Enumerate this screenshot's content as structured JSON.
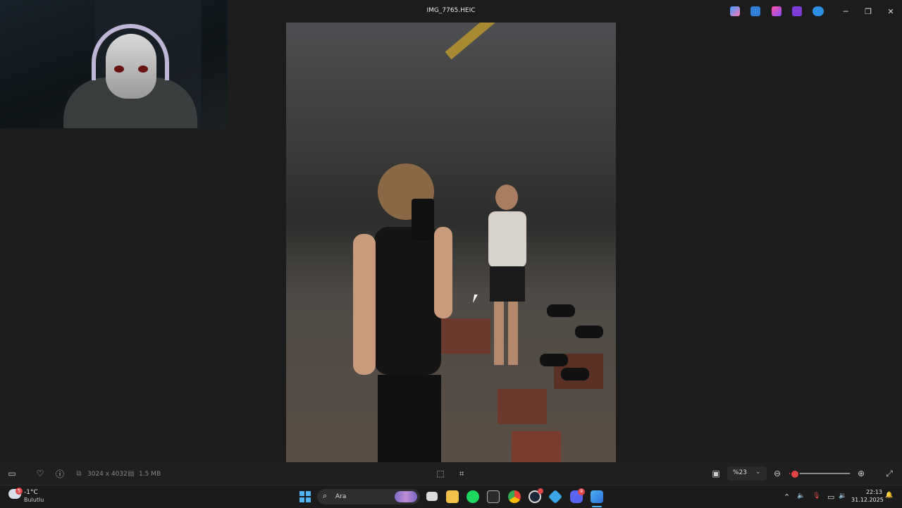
{
  "window": {
    "title": "IMG_7765.HEIC"
  },
  "title_bar_icons": [
    "copilot-icon",
    "photos-edit-icon",
    "clipchamp-icon",
    "designer-icon",
    "onedrive-icon"
  ],
  "window_controls": {
    "minimize": "─",
    "restore": "❐",
    "close": "✕"
  },
  "toolbar": {
    "dimensions": "3024 x 4032",
    "file_size": "1.5 MB",
    "zoom_value": "%23",
    "filmstrip_glyph": "▭",
    "favorite_glyph": "♡",
    "info_glyph": "ⓘ",
    "dims_glyph": "⧉",
    "size_glyph": "▤",
    "crop_glyph": "⬚",
    "erase_glyph": "⌗",
    "snapshot_glyph": "▣",
    "zoom_out_glyph": "⊖",
    "zoom_in_glyph": "⊕",
    "fullscreen_glyph": "⤢",
    "chevron_glyph": "⌄",
    "zoom_level_fraction": 0.07
  },
  "taskbar": {
    "weather": {
      "temperature": "-1°C",
      "description": "Bulutlu",
      "badge": "5"
    },
    "search": {
      "label": "Ara",
      "glyph": "⌕"
    },
    "apps": [
      "file-explorer-window-icon",
      "file-explorer-icon",
      "spotify-icon",
      "epic-games-icon",
      "chrome-icon",
      "steam-icon",
      "battle-net-icon",
      "discord-icon",
      "photos-icon"
    ],
    "discord_badge": "9",
    "tray": {
      "chevron": "⌃",
      "speaker_glyph": "🔈",
      "mic_glyph": "🎙",
      "network_glyph": "▭",
      "volume_glyph": "🔉",
      "notification_glyph": "🔔"
    },
    "clock": {
      "time": "22:13",
      "date": "31.12.2025"
    }
  },
  "colors": {
    "accent": "#4fb3f5",
    "slider": "#e04545",
    "badge": "#e24646"
  }
}
